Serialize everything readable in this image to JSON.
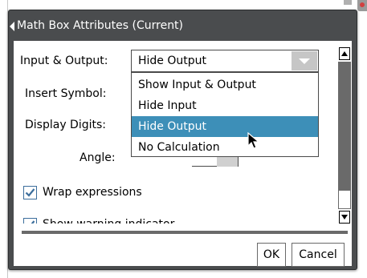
{
  "dialog": {
    "title": "Math Box Attributes (Current)"
  },
  "fields": {
    "input_output_label": "Input & Output:",
    "insert_symbol_label": "Insert Symbol:",
    "display_digits_label": "Display Digits:",
    "angle_label": "Angle:"
  },
  "combo": {
    "value": "Hide Output",
    "icon": "chevron-down-icon"
  },
  "dropdown": {
    "options": [
      "Show Input & Output",
      "Hide Input",
      "Hide Output",
      "No Calculation"
    ],
    "selected_index": 2
  },
  "checkboxes": [
    {
      "label": "Wrap expressions",
      "checked": true
    },
    {
      "label": "Show warning indicator",
      "checked": true
    }
  ],
  "buttons": {
    "ok": "OK",
    "cancel": "Cancel"
  },
  "colors": {
    "dialog_frame": "#4a4c4e",
    "selection": "#3d8fb8",
    "checkbox": "#3c6e9c"
  }
}
